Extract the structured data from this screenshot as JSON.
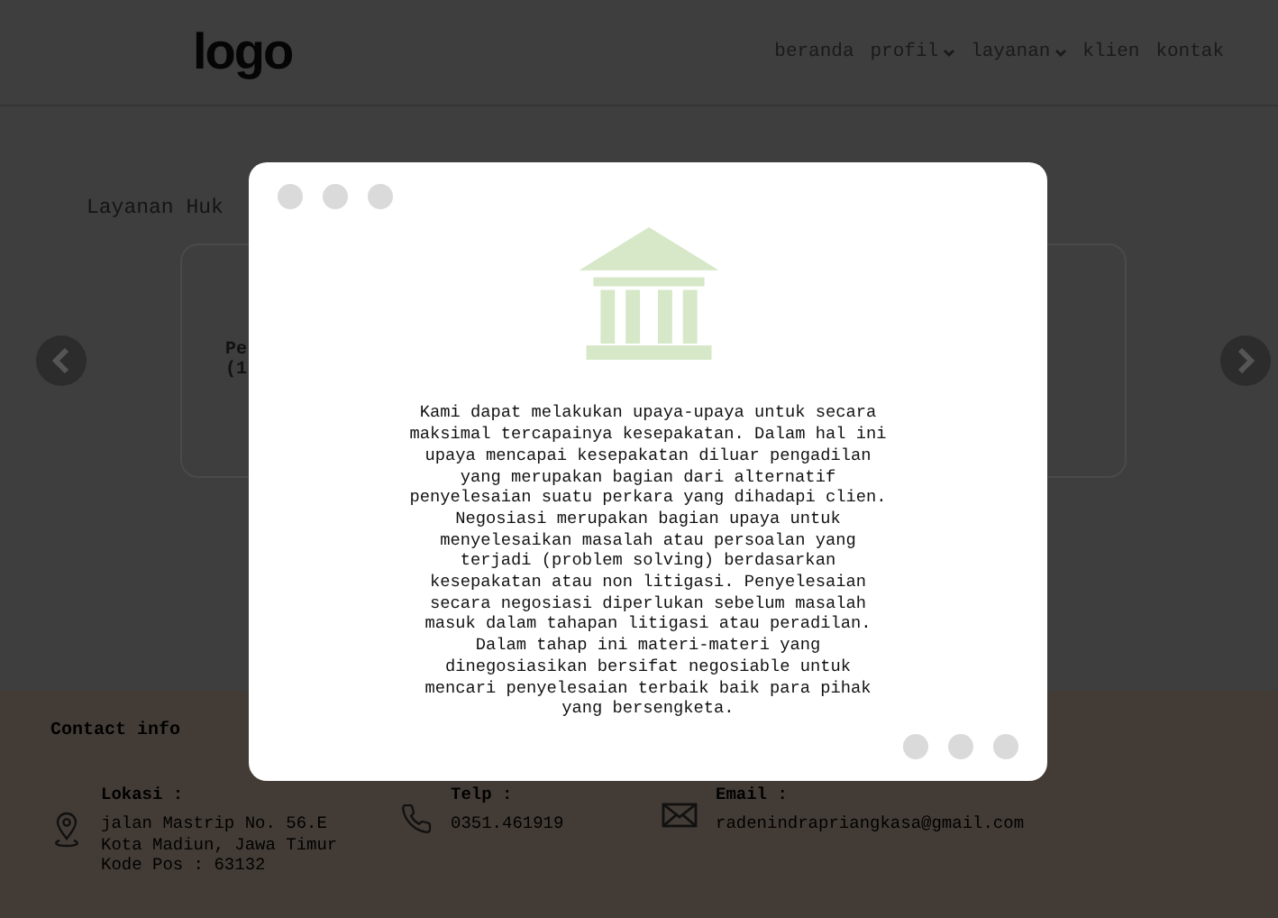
{
  "header": {
    "logo": "logo",
    "nav": [
      {
        "label": "beranda",
        "dropdown": false
      },
      {
        "label": "profil",
        "dropdown": true
      },
      {
        "label": "layanan",
        "dropdown": true
      },
      {
        "label": "klien",
        "dropdown": false
      },
      {
        "label": "kontak",
        "dropdown": false
      }
    ]
  },
  "section": {
    "title": "Layanan Huk",
    "card_text": [
      "Pe",
      "(1"
    ]
  },
  "modal": {
    "lines": [
      "Kami dapat melakukan upaya-upaya untuk secara",
      "maksimal tercapainya kesepakatan. Dalam hal ini",
      "upaya mencapai kesepakatan diluar pengadilan",
      "yang merupakan bagian dari alternatif",
      "penyelesaian suatu perkara yang dihadapi clien.",
      "Negosiasi merupakan bagian upaya untuk",
      "menyelesaikan masalah atau persoalan yang",
      "terjadi (problem solving) berdasarkan",
      "kesepakatan atau non litigasi. Penyelesaian",
      "secara negosiasi diperlukan sebelum masalah",
      "masuk dalam tahapan litigasi atau peradilan.",
      "Dalam tahap ini materi-materi yang",
      "dinegosiasikan bersifat negosiable untuk",
      "mencari penyelesaian terbaik baik para pihak",
      "yang bersengketa."
    ]
  },
  "footer": {
    "title": "Contact info",
    "items": [
      {
        "kind": "location",
        "label": "Lokasi :",
        "lines": [
          "jalan Mastrip No. 56.E",
          "Kota Madiun, Jawa Timur",
          "Kode Pos : 63132"
        ]
      },
      {
        "kind": "phone",
        "label": "Telp :",
        "lines": [
          "0351.461919"
        ]
      },
      {
        "kind": "email",
        "label": "Email :",
        "lines": [
          "radenindrapriangkasa@gmail.com"
        ]
      }
    ]
  }
}
